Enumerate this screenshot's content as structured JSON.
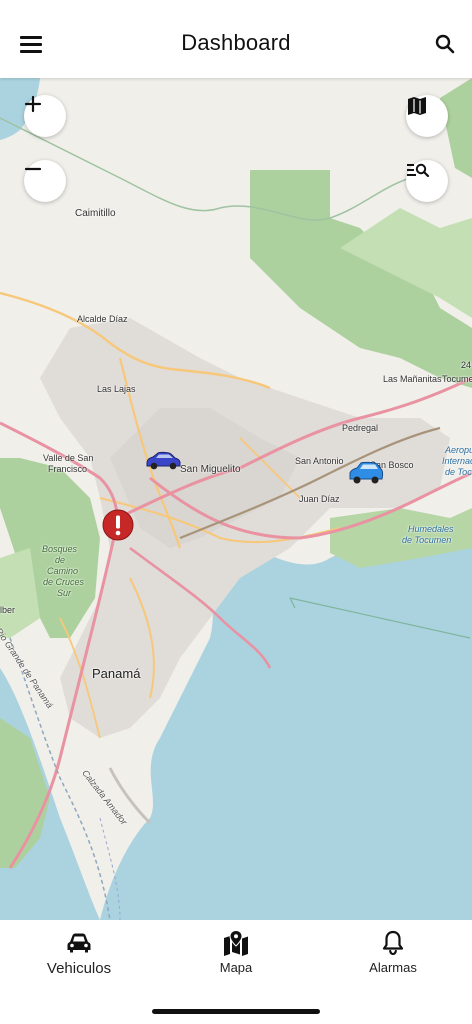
{
  "header": {
    "title": "Dashboard"
  },
  "map": {
    "places": [
      {
        "id": "caimitillo",
        "label": "Caimitillo"
      },
      {
        "id": "alcalde-diaz",
        "label": "Alcalde Díaz"
      },
      {
        "id": "las-lajas",
        "label": "Las Lajas"
      },
      {
        "id": "valle-1",
        "label": "Valle de San"
      },
      {
        "id": "valle-2",
        "label": "Francisco"
      },
      {
        "id": "san-miguelito",
        "label": "San Miguelito"
      },
      {
        "id": "san-antonio",
        "label": "San Antonio"
      },
      {
        "id": "pedregal",
        "label": "Pedregal"
      },
      {
        "id": "juan-diaz",
        "label": "Juan Díaz"
      },
      {
        "id": "san-bosco",
        "label": "San Bosco"
      },
      {
        "id": "las-mananitas",
        "label": "Las Mañanitas"
      },
      {
        "id": "tocumen",
        "label": "Tocumen"
      },
      {
        "id": "route-24",
        "label": "24"
      },
      {
        "id": "aeropuerto-1",
        "label": "Aeropue"
      },
      {
        "id": "aeropuerto-2",
        "label": "Internaci"
      },
      {
        "id": "aeropuerto-3",
        "label": "de Tocu"
      },
      {
        "id": "humedales-1",
        "label": "Humedales"
      },
      {
        "id": "humedales-2",
        "label": "de Tocumen"
      },
      {
        "id": "bosques-1",
        "label": "Bosques"
      },
      {
        "id": "bosques-2",
        "label": "de"
      },
      {
        "id": "bosques-3",
        "label": "Camino"
      },
      {
        "id": "bosques-4",
        "label": "de Cruces"
      },
      {
        "id": "bosques-5",
        "label": "Sur"
      },
      {
        "id": "panama",
        "label": "Panamá"
      },
      {
        "id": "rio-label",
        "label": "Rio Grande de Panamá"
      },
      {
        "id": "amador",
        "label": "Calzada Amador"
      },
      {
        "id": "lber",
        "label": "lber"
      }
    ]
  },
  "nav": {
    "items": [
      {
        "id": "vehiculos",
        "label": "Vehiculos"
      },
      {
        "id": "mapa",
        "label": "Mapa"
      },
      {
        "id": "alarmas",
        "label": "Alarmas"
      }
    ]
  },
  "colors": {
    "accent": "#111111",
    "alarm_marker": "#c62828",
    "water": "#aad3df",
    "forest": "#add19e",
    "primary_road": "#e892a2",
    "secondary_road": "#f7c87a"
  }
}
